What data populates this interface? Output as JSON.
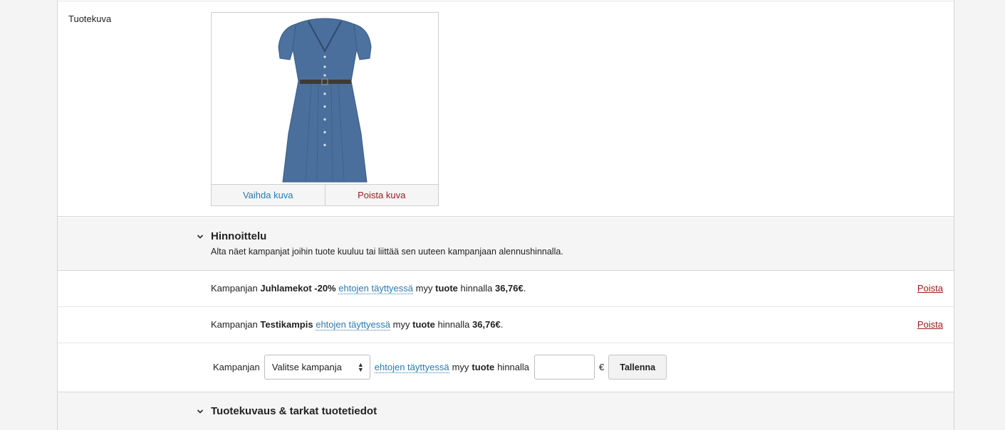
{
  "image_section": {
    "label": "Tuotekuva",
    "change_label": "Vaihda kuva",
    "remove_label": "Poista kuva"
  },
  "pricing": {
    "title": "Hinnoittelu",
    "description": "Alta näet kampanjat joihin tuote kuuluu tai liittää sen uuteen kampanjaan alennushinnalla.",
    "campaigns": [
      {
        "prefix": "Kampanjan",
        "name": "Juhlamekot -20%",
        "condition_link": "ehtojen täyttyessä",
        "sells": "myy",
        "product": "tuote",
        "at_price": "hinnalla",
        "price": "36,76€",
        "end": ".",
        "remove_label": "Poista"
      },
      {
        "prefix": "Kampanjan",
        "name": "Testikampis",
        "condition_link": "ehtojen täyttyessä",
        "sells": "myy",
        "product": "tuote",
        "at_price": "hinnalla",
        "price": "36,76€",
        "end": ".",
        "remove_label": "Poista"
      }
    ],
    "add": {
      "prefix": "Kampanjan",
      "select_value": "Valitse kampanja",
      "condition_link": "ehtojen täyttyessä",
      "sells": "myy",
      "product": "tuote",
      "at_price": "hinnalla",
      "price_value": "",
      "currency": "€",
      "save_label": "Tallenna"
    }
  },
  "description_section": {
    "title": "Tuotekuvaus & tarkat tuotetiedot"
  },
  "colors": {
    "link": "#2a7ab0",
    "danger": "#9a1a1a",
    "dress": "#4a6f9c"
  }
}
